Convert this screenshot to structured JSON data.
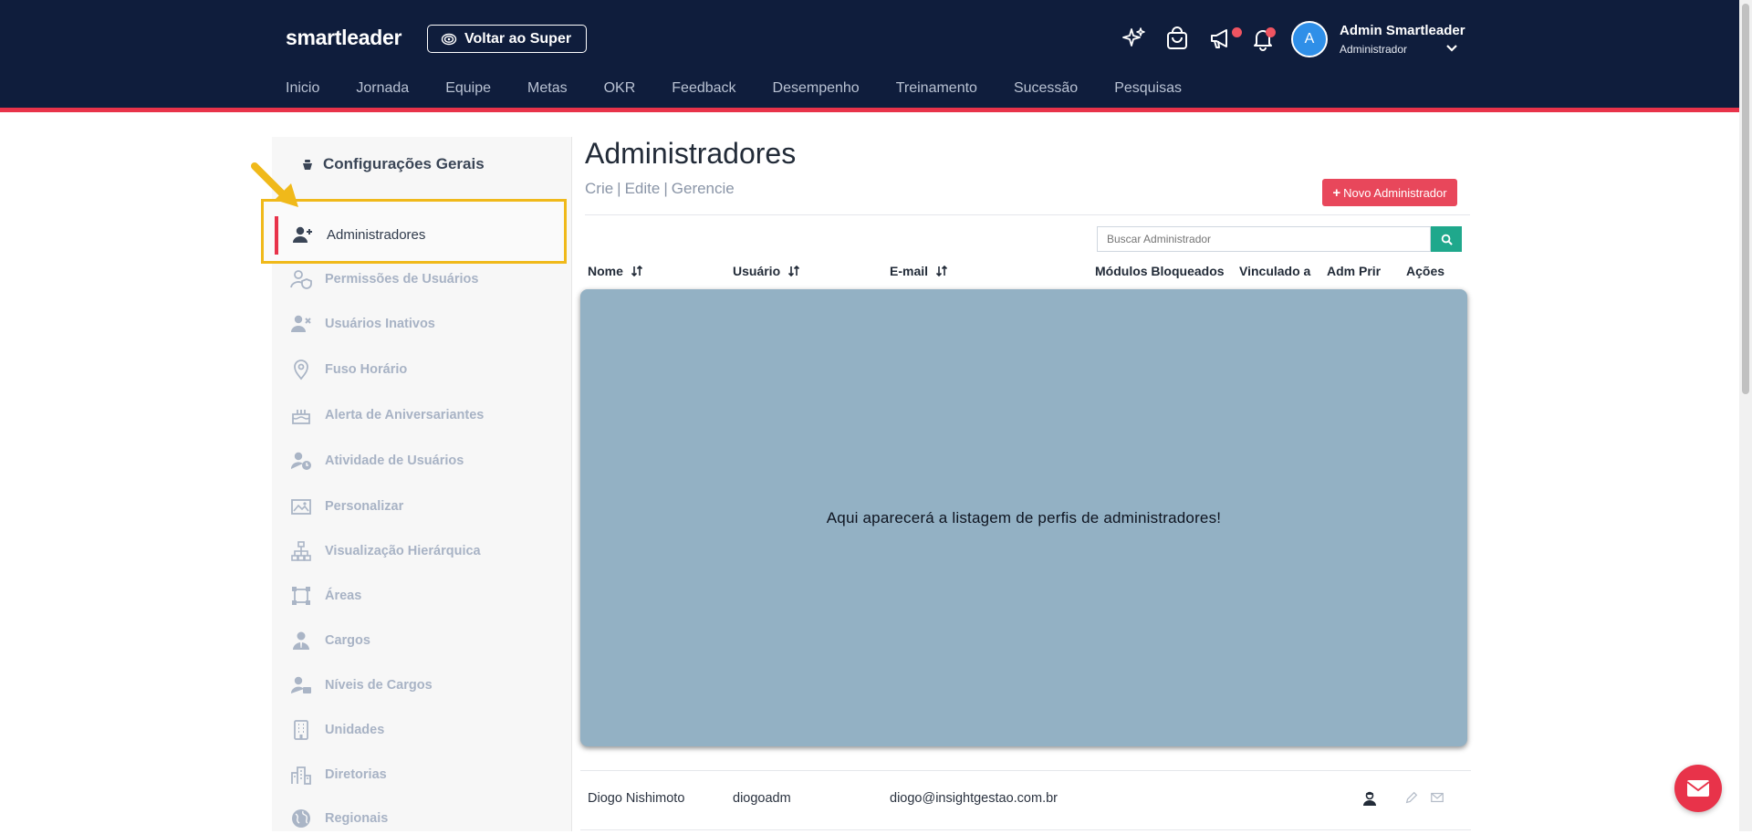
{
  "header": {
    "brand": "smartleader",
    "back_button": "Voltar ao Super",
    "icons": [
      "sparkles-icon",
      "shopping-bag-icon",
      "megaphone-icon",
      "bell-icon"
    ],
    "user": {
      "initial": "A",
      "name": "Admin Smartleader",
      "role": "Administrador"
    },
    "nav": [
      "Inicio",
      "Jornada",
      "Equipe",
      "Metas",
      "OKR",
      "Feedback",
      "Desempenho",
      "Treinamento",
      "Sucessão",
      "Pesquisas"
    ]
  },
  "sidebar": {
    "title": "Configurações Gerais",
    "items": [
      {
        "label": "Administradores",
        "icon": "user-plus-icon",
        "active": true
      },
      {
        "label": "Permissões de Usuários",
        "icon": "user-shield-icon"
      },
      {
        "label": "Usuários Inativos",
        "icon": "user-x-icon"
      },
      {
        "label": "Fuso Horário",
        "icon": "map-pin-icon"
      },
      {
        "label": "Alerta de Aniversariantes",
        "icon": "cake-icon"
      },
      {
        "label": "Atividade de Usuários",
        "icon": "user-clock-icon"
      },
      {
        "label": "Personalizar",
        "icon": "images-icon"
      },
      {
        "label": "Visualização Hierárquica",
        "icon": "hierarchy-icon"
      },
      {
        "label": "Áreas",
        "icon": "area-icon"
      },
      {
        "label": "Cargos",
        "icon": "user-tie-icon"
      },
      {
        "label": "Níveis de Cargos",
        "icon": "users-level-icon"
      },
      {
        "label": "Unidades",
        "icon": "building-icon"
      },
      {
        "label": "Diretorias",
        "icon": "city-icon"
      },
      {
        "label": "Regionais",
        "icon": "globe-icon"
      }
    ]
  },
  "main": {
    "title": "Administradores",
    "crumbs": [
      "Crie",
      "Edite",
      "Gerencie"
    ],
    "new_button": "Novo Administrador",
    "search_placeholder": "Buscar Administrador",
    "columns": [
      "Nome",
      "Usuário",
      "E-mail",
      "Módulos Bloqueados",
      "Vinculado a",
      "Adm Prir",
      "Ações"
    ],
    "overlay_text": "Aqui aparecerá a listagem de perfis de administradores!",
    "rows": [
      {
        "name": "Diogo Nishimoto",
        "user": "diogoadm",
        "email": "diogo@insightgestao.com.br"
      }
    ]
  },
  "colors": {
    "header_bg": "#0f1d3c",
    "accent_red": "#e8334a",
    "highlight_yellow": "#f0b91a",
    "search_green": "#1fa88c",
    "overlay": "#93b1c4"
  }
}
